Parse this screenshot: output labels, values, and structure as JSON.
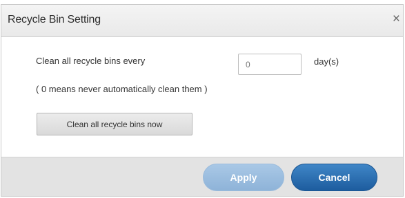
{
  "dialog": {
    "title": "Recycle Bin Setting",
    "close_glyph": "×"
  },
  "settings": {
    "clean_every_label": "Clean all recycle bins every",
    "days_value": "0",
    "unit_label": "day(s)",
    "note": "( 0 means never automatically clean them )",
    "clean_now_label": "Clean all recycle bins now"
  },
  "footer": {
    "apply_label": "Apply",
    "cancel_label": "Cancel"
  },
  "colors": {
    "apply_bg": "#9dbfe0",
    "cancel_bg": "#2b6fb3",
    "footer_bg": "#e3e3e3"
  }
}
